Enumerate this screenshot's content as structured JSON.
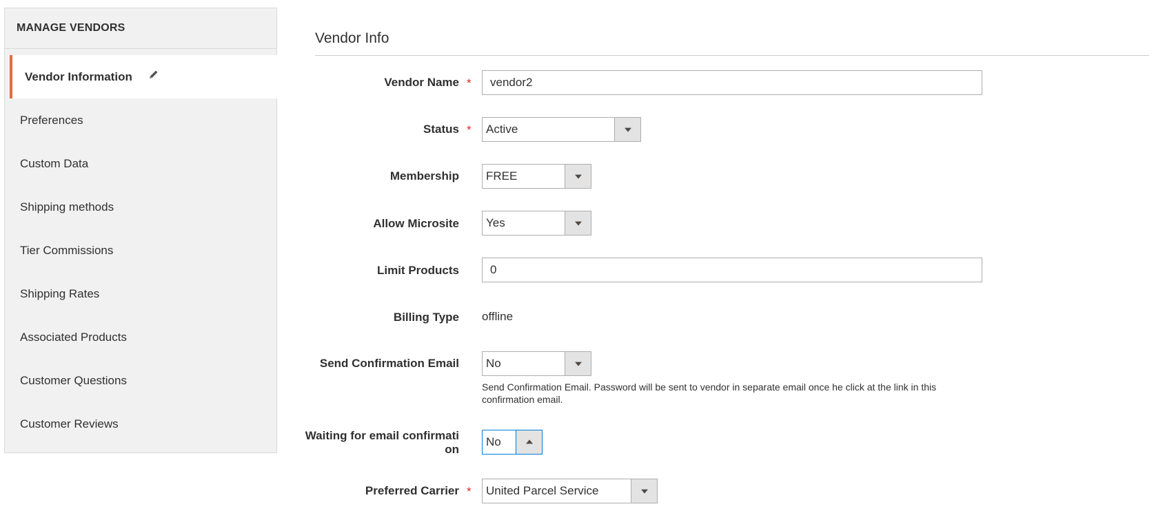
{
  "sidebar": {
    "title": "MANAGE VENDORS",
    "items": [
      {
        "label": "Vendor Information"
      },
      {
        "label": "Preferences"
      },
      {
        "label": "Custom Data"
      },
      {
        "label": "Shipping methods"
      },
      {
        "label": "Tier Commissions"
      },
      {
        "label": "Shipping Rates"
      },
      {
        "label": "Associated Products"
      },
      {
        "label": "Customer Questions"
      },
      {
        "label": "Customer Reviews"
      }
    ],
    "active_index": 0
  },
  "section": {
    "title": "Vendor Info"
  },
  "required_marker": "*",
  "fields": {
    "vendor_name": {
      "label": "Vendor Name",
      "value": "vendor2"
    },
    "status": {
      "label": "Status",
      "value": "Active"
    },
    "membership": {
      "label": "Membership",
      "value": "FREE"
    },
    "allow_microsite": {
      "label": "Allow Microsite",
      "value": "Yes"
    },
    "limit_products": {
      "label": "Limit Products",
      "value": "0"
    },
    "billing_type": {
      "label": "Billing Type",
      "value": "offline"
    },
    "send_confirmation": {
      "label": "Send Confirmation Email",
      "value": "No",
      "note": "Send Confirmation Email. Password will be sent to vendor in separate email once he click at the link in this confirmation email."
    },
    "waiting_confirmation": {
      "label_line1": "Waiting for email confirmati",
      "label_line2": "on",
      "value": "No"
    },
    "preferred_carrier": {
      "label": "Preferred Carrier",
      "value": "United Parcel Service"
    }
  },
  "colors": {
    "accent": "#e46d3c",
    "required": "#e22626",
    "focus": "#007bdb"
  },
  "icons": {
    "edit": "pencil-icon",
    "dropdown": "chevron-down-icon",
    "dropup": "chevron-up-icon"
  }
}
